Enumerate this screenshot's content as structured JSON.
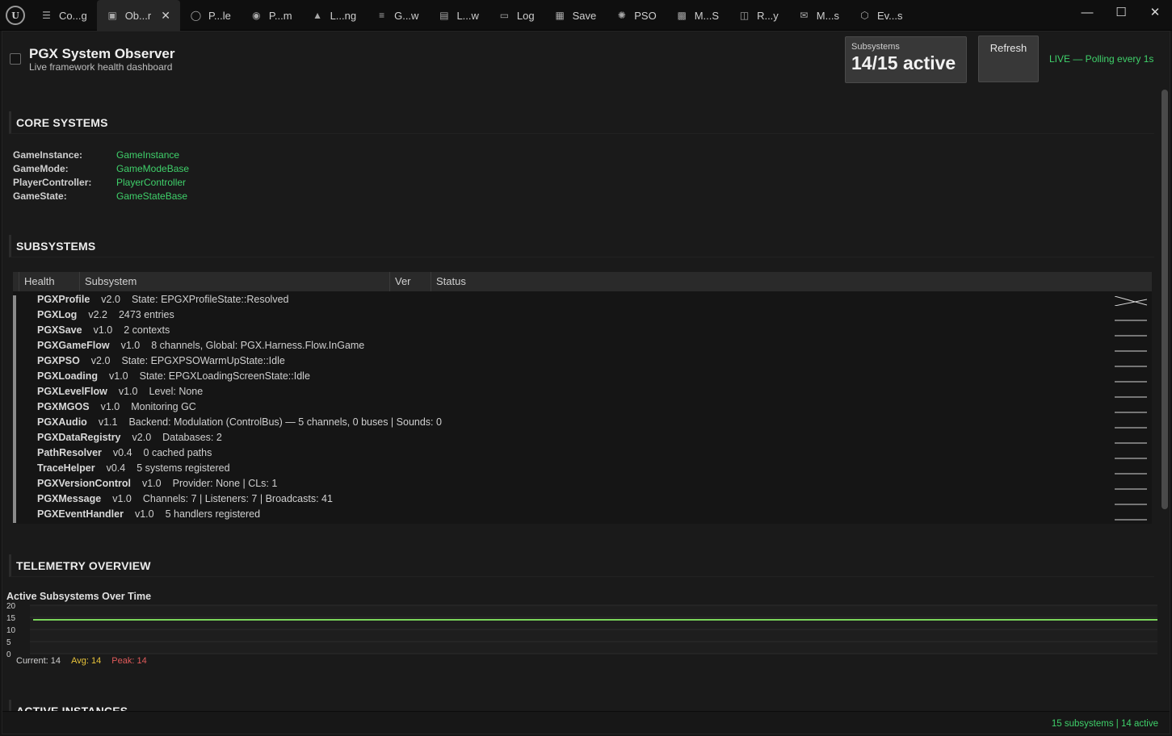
{
  "tabs": [
    {
      "label": "Co...g",
      "icon": "stack-icon",
      "name": "tab-config"
    },
    {
      "label": "Ob...r",
      "icon": "monitor-icon",
      "name": "tab-observer",
      "active": true
    },
    {
      "label": "P...le",
      "icon": "shield-icon",
      "name": "tab-profile"
    },
    {
      "label": "P...m",
      "icon": "palette-icon",
      "name": "tab-platform"
    },
    {
      "label": "L...ng",
      "icon": "loading-icon",
      "name": "tab-loading"
    },
    {
      "label": "G...w",
      "icon": "flow-icon",
      "name": "tab-gameflow"
    },
    {
      "label": "L...w",
      "icon": "levels-icon",
      "name": "tab-levelflow"
    },
    {
      "label": "Log",
      "icon": "log-icon",
      "name": "tab-log"
    },
    {
      "label": "Save",
      "icon": "save-icon",
      "name": "tab-save"
    },
    {
      "label": "PSO",
      "icon": "spinner-icon",
      "name": "tab-pso"
    },
    {
      "label": "M...S",
      "icon": "chip-icon",
      "name": "tab-mgos"
    },
    {
      "label": "R...y",
      "icon": "database-icon",
      "name": "tab-registry"
    },
    {
      "label": "M...s",
      "icon": "mail-icon",
      "name": "tab-messages"
    },
    {
      "label": "Ev...s",
      "icon": "hexagon-icon",
      "name": "tab-events"
    }
  ],
  "header": {
    "title": "PGX System Observer",
    "subtitle": "Live framework health dashboard",
    "stat_label": "Subsystems",
    "stat_value": "14/15 active",
    "refresh_label": "Refresh",
    "live_text": "LIVE — Polling every 1s"
  },
  "core": {
    "title": "CORE SYSTEMS",
    "items": [
      {
        "key": "GameInstance:",
        "value": "GameInstance"
      },
      {
        "key": "GameMode:",
        "value": "GameModeBase"
      },
      {
        "key": "PlayerController:",
        "value": "PlayerController"
      },
      {
        "key": "GameState:",
        "value": "GameStateBase"
      }
    ]
  },
  "subsystems": {
    "title": "SUBSYSTEMS",
    "columns": [
      "Health",
      "Subsystem",
      "Ver",
      "Status"
    ],
    "rows": [
      {
        "name": "PGXProfile",
        "ver": "v2.0",
        "status": "State: EPGXProfileState::Resolved"
      },
      {
        "name": "PGXLog",
        "ver": "v2.2",
        "status": "2473 entries"
      },
      {
        "name": "PGXSave",
        "ver": "v1.0",
        "status": "2 contexts"
      },
      {
        "name": "PGXGameFlow",
        "ver": "v1.0",
        "status": "8 channels, Global: PGX.Harness.Flow.InGame"
      },
      {
        "name": "PGXPSO",
        "ver": "v2.0",
        "status": "State: EPGXPSOWarmUpState::Idle"
      },
      {
        "name": "PGXLoading",
        "ver": "v1.0",
        "status": "State: EPGXLoadingScreenState::Idle"
      },
      {
        "name": "PGXLevelFlow",
        "ver": "v1.0",
        "status": "Level: None"
      },
      {
        "name": "PGXMGOS",
        "ver": "v1.0",
        "status": "Monitoring GC"
      },
      {
        "name": "PGXAudio",
        "ver": "v1.1",
        "status": "Backend: Modulation (ControlBus) — 5 channels, 0 buses | Sounds: 0"
      },
      {
        "name": "PGXDataRegistry",
        "ver": "v2.0",
        "status": "Databases: 2"
      },
      {
        "name": "PathResolver",
        "ver": "v0.4",
        "status": "0 cached paths"
      },
      {
        "name": "TraceHelper",
        "ver": "v0.4",
        "status": "5 systems registered"
      },
      {
        "name": "PGXVersionControl",
        "ver": "v1.0",
        "status": "Provider: None | CLs: 1"
      },
      {
        "name": "PGXMessage",
        "ver": "v1.0",
        "status": "Channels: 7 | Listeners: 7 | Broadcasts: 41"
      },
      {
        "name": "PGXEventHandler",
        "ver": "v1.0",
        "status": "5 handlers registered"
      }
    ]
  },
  "telemetry": {
    "title": "TELEMETRY OVERVIEW",
    "legend_current": "Current: 14",
    "legend_avg": "Avg: 14",
    "legend_peak": "Peak: 14"
  },
  "chart_data": {
    "type": "line",
    "title": "Active Subsystems Over Time",
    "ylim": [
      0,
      20
    ],
    "yticks": [
      20,
      15,
      10,
      5,
      0
    ],
    "series": [
      {
        "values": [
          14,
          14,
          14,
          14,
          14,
          14,
          14,
          14,
          14,
          14
        ]
      }
    ],
    "grid": true,
    "color": "#7ad65a"
  },
  "next_section": {
    "title": "ACTIVE INSTANCES"
  },
  "status_bar": {
    "text": "15 subsystems | 14 active"
  },
  "colors": {
    "accent_green": "#3fd06a",
    "avg": "#e8c33a",
    "peak": "#e05a5a"
  }
}
